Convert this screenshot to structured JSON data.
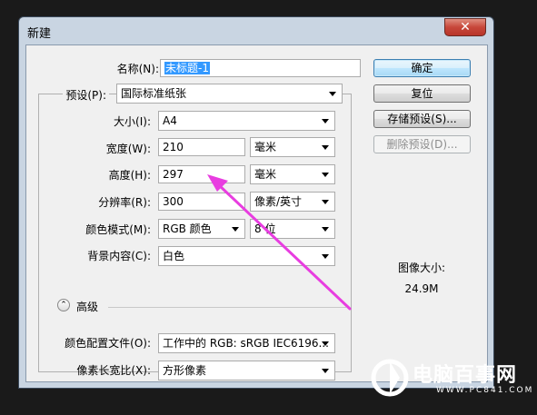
{
  "window": {
    "title": "新建",
    "close_glyph": "✕"
  },
  "form": {
    "name_label": "名称(N):",
    "name_value": "未标题-1",
    "preset_label": "预设(P):",
    "preset_value": "国际标准纸张",
    "size_label": "大小(I):",
    "size_value": "A4",
    "width_label": "宽度(W):",
    "width_value": "210",
    "width_unit": "毫米",
    "height_label": "高度(H):",
    "height_value": "297",
    "height_unit": "毫米",
    "resolution_label": "分辨率(R):",
    "resolution_value": "300",
    "resolution_unit": "像素/英寸",
    "colormode_label": "颜色模式(M):",
    "colormode_value": "RGB 颜色",
    "bitdepth_value": "8 位",
    "bg_label": "背景内容(C):",
    "bg_value": "白色",
    "advanced_label": "高级",
    "expander_glyph": "⌃",
    "profile_label": "颜色配置文件(O):",
    "profile_value": "工作中的 RGB: sRGB IEC6196...",
    "aspect_label": "像素长宽比(X):",
    "aspect_value": "方形像素"
  },
  "buttons": {
    "ok": "确定",
    "reset": "复位",
    "save_preset": "存储预设(S)...",
    "delete_preset": "删除预设(D)..."
  },
  "image_size": {
    "label": "图像大小:",
    "value": "24.9M"
  },
  "watermark": {
    "text": "电脑百事网",
    "url": "WWW.PC841.COM"
  },
  "colors": {
    "annotation_arrow": "#e83de0",
    "accent": "#3399ff"
  },
  "icons": {
    "close": "close-icon",
    "expander": "chevron-up-icon",
    "dropdown": "dropdown-arrow-icon"
  }
}
